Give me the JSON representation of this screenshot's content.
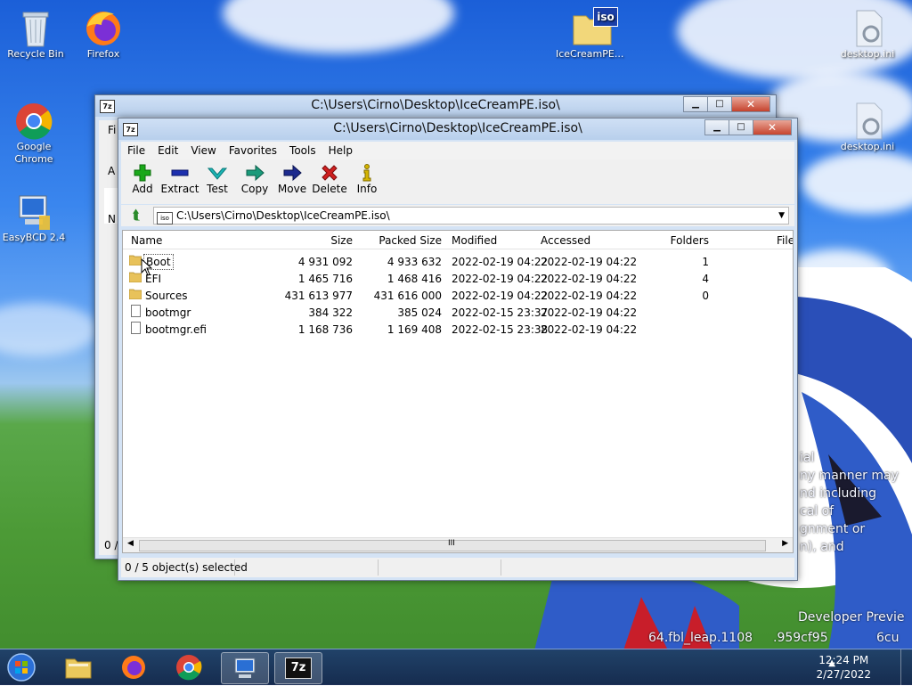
{
  "desktop": {
    "icons": [
      {
        "label": "Recycle Bin",
        "name": "recycle-bin-icon"
      },
      {
        "label": "Firefox",
        "name": "firefox-icon"
      },
      {
        "label": "IceCreamPE...",
        "name": "iso-file-icon"
      },
      {
        "label": "desktop.ini",
        "name": "settings-file-icon"
      },
      {
        "label": "Google Chrome",
        "name": "chrome-icon"
      },
      {
        "label": "desktop.ini",
        "name": "settings-file-icon"
      },
      {
        "label": "EasyBCD 2.4",
        "name": "easybcd-icon"
      }
    ],
    "iso_badge": "iso",
    "watermark": [
      "ial",
      "ny manner may",
      "nd including",
      "cal of",
      "gnment or",
      "n), and",
      "Developer Previe",
      "64.fbl_leap.1108",
      ".959cf95",
      "6cu"
    ]
  },
  "back_window": {
    "title": "C:\\Users\\Cirno\\Desktop\\IceCreamPE.iso\\",
    "app_icon": "7z",
    "peek": {
      "f": "Fi",
      "a": "A",
      "n": "N",
      "status": "0 /"
    }
  },
  "window": {
    "title": "C:\\Users\\Cirno\\Desktop\\IceCreamPE.iso\\",
    "app_icon": "7z",
    "menu": [
      "File",
      "Edit",
      "View",
      "Favorites",
      "Tools",
      "Help"
    ],
    "toolbar": [
      {
        "label": "Add",
        "icon": "plus-icon",
        "color": "#1aa81a"
      },
      {
        "label": "Extract",
        "icon": "minus-icon",
        "color": "#1c2fae"
      },
      {
        "label": "Test",
        "icon": "check-icon",
        "color": "#1bb5b5"
      },
      {
        "label": "Copy",
        "icon": "copy-arrow-icon",
        "color": "#1a9a7a"
      },
      {
        "label": "Move",
        "icon": "move-arrow-icon",
        "color": "#1c2a8e"
      },
      {
        "label": "Delete",
        "icon": "delete-icon",
        "color": "#d01f1f"
      },
      {
        "label": "Info",
        "icon": "info-icon",
        "color": "#d4b400"
      }
    ],
    "address": "C:\\Users\\Cirno\\Desktop\\IceCreamPE.iso\\",
    "address_icon": "iso",
    "columns": [
      "Name",
      "Size",
      "Packed Size",
      "Modified",
      "Accessed",
      "Folders",
      "File"
    ],
    "rows": [
      {
        "name": "Boot",
        "type": "folder",
        "size": "4 931 092",
        "packed": "4 933 632",
        "modified": "2022-02-19 04:22",
        "accessed": "2022-02-19 04:22",
        "folders": "1"
      },
      {
        "name": "EFI",
        "type": "folder",
        "size": "1 465 716",
        "packed": "1 468 416",
        "modified": "2022-02-19 04:22",
        "accessed": "2022-02-19 04:22",
        "folders": "4"
      },
      {
        "name": "Sources",
        "type": "folder",
        "size": "431 613 977",
        "packed": "431 616 000",
        "modified": "2022-02-19 04:22",
        "accessed": "2022-02-19 04:22",
        "folders": "0"
      },
      {
        "name": "bootmgr",
        "type": "file",
        "size": "384 322",
        "packed": "385 024",
        "modified": "2022-02-15 23:37",
        "accessed": "2022-02-19 04:22",
        "folders": ""
      },
      {
        "name": "bootmgr.efi",
        "type": "file",
        "size": "1 168 736",
        "packed": "1 169 408",
        "modified": "2022-02-15 23:38",
        "accessed": "2022-02-19 04:22",
        "folders": ""
      }
    ],
    "status": "0 / 5 object(s) selected",
    "scroll_grip": "III"
  },
  "taskbar": {
    "time": "12:24 PM",
    "date": "2/27/2022",
    "tray_arrow": "▲",
    "active_label": "7z"
  }
}
